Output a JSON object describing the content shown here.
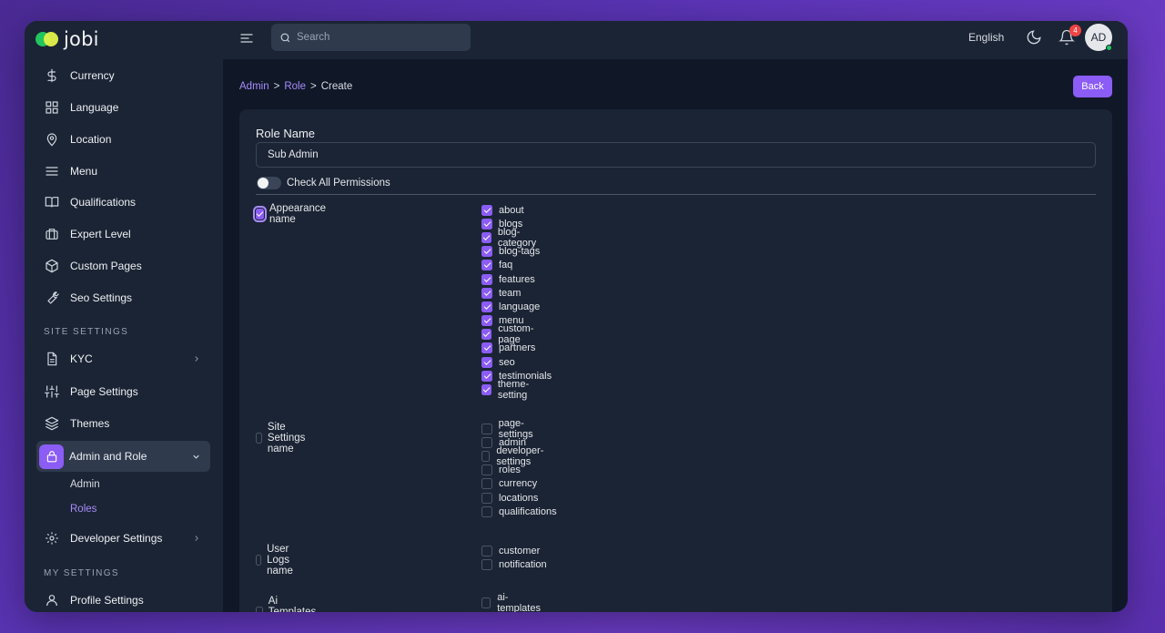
{
  "brand": {
    "name": "jobi"
  },
  "sidebar": {
    "items": [
      {
        "label": "Currency",
        "icon": "dollar-icon"
      },
      {
        "label": "Language",
        "icon": "grid-icon"
      },
      {
        "label": "Location",
        "icon": "map-pin-icon"
      },
      {
        "label": "Menu",
        "icon": "menu-icon"
      },
      {
        "label": "Qualifications",
        "icon": "book-icon"
      },
      {
        "label": "Expert Level",
        "icon": "briefcase-icon"
      },
      {
        "label": "Custom Pages",
        "icon": "box-icon"
      },
      {
        "label": "Seo Settings",
        "icon": "wrench-icon"
      }
    ],
    "section_site": "SITE SETTINGS",
    "site_items": [
      {
        "label": "KYC",
        "icon": "document-icon"
      },
      {
        "label": "Page Settings",
        "icon": "sliders-icon"
      },
      {
        "label": "Themes",
        "icon": "layers-icon"
      },
      {
        "label": "Admin and Role",
        "icon": "lock-icon"
      }
    ],
    "admin_sub": [
      {
        "label": "Admin"
      },
      {
        "label": "Roles"
      }
    ],
    "developer": {
      "label": "Developer Settings",
      "icon": "gear-icon"
    },
    "section_my": "MY SETTINGS",
    "profile": {
      "label": "Profile Settings",
      "icon": "user-icon"
    }
  },
  "topbar": {
    "search_placeholder": "Search",
    "language": "English",
    "notification_count": "4",
    "avatar_initials": "AD"
  },
  "breadcrumb": {
    "admin": "Admin",
    "role": "Role",
    "current": "Create",
    "sep": ">"
  },
  "back_label": "Back",
  "form": {
    "role_name_label": "Role Name",
    "role_name_value": "Sub Admin",
    "check_all_label": "Check All Permissions",
    "check_all_on": false,
    "groups": [
      {
        "name": "Appearance name",
        "checked": true,
        "permissions": [
          {
            "label": "about",
            "checked": true
          },
          {
            "label": "blogs",
            "checked": true
          },
          {
            "label": "blog-category",
            "checked": true
          },
          {
            "label": "blog-tags",
            "checked": true
          },
          {
            "label": "faq",
            "checked": true
          },
          {
            "label": "features",
            "checked": true
          },
          {
            "label": "team",
            "checked": true
          },
          {
            "label": "language",
            "checked": true
          },
          {
            "label": "menu",
            "checked": true
          },
          {
            "label": "custom-page",
            "checked": true
          },
          {
            "label": "partners",
            "checked": true
          },
          {
            "label": "seo",
            "checked": true
          },
          {
            "label": "testimonials",
            "checked": true
          },
          {
            "label": "theme-setting",
            "checked": true
          }
        ]
      },
      {
        "name": "Site Settings name",
        "checked": false,
        "permissions": [
          {
            "label": "page-settings",
            "checked": false
          },
          {
            "label": "admin",
            "checked": false
          },
          {
            "label": "developer-settings",
            "checked": false
          },
          {
            "label": "roles",
            "checked": false
          },
          {
            "label": "currency",
            "checked": false
          },
          {
            "label": "locations",
            "checked": false
          },
          {
            "label": "qualifications",
            "checked": false
          }
        ]
      },
      {
        "name": "User Logs name",
        "checked": false,
        "permissions": [
          {
            "label": "customer",
            "checked": false
          },
          {
            "label": "notification",
            "checked": false
          }
        ]
      },
      {
        "name": "Ai Templates name",
        "checked": false,
        "permissions": [
          {
            "label": "ai-templates",
            "checked": false
          }
        ]
      }
    ]
  },
  "colors": {
    "accent": "#8b5cf6",
    "panel": "#1b2434",
    "background": "#101828"
  }
}
